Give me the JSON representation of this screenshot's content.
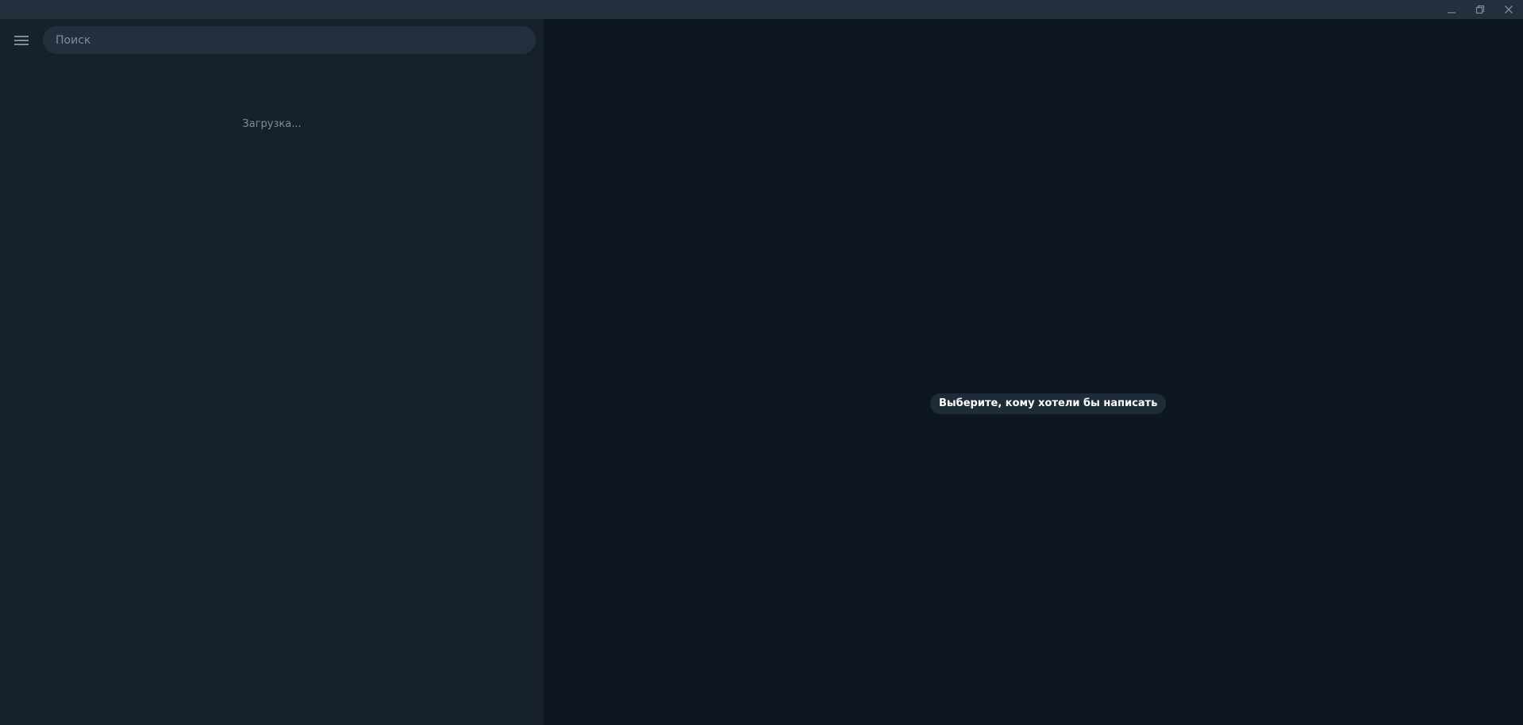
{
  "window": {
    "controls": [
      {
        "name": "minimize-icon"
      },
      {
        "name": "restore-icon"
      },
      {
        "name": "close-icon"
      }
    ]
  },
  "sidebar": {
    "menu_icon": "hamburger-menu-icon",
    "search": {
      "placeholder": "Поиск",
      "value": ""
    },
    "status": "Загрузка..."
  },
  "main": {
    "empty_message": "Выберите, кому хотели бы написать"
  },
  "colors": {
    "titlebar": "#242f3d",
    "sidebar_bg": "#17212b",
    "main_bg": "#0e1621",
    "search_bg": "#242f3d",
    "pill_bg": "#1e2c3a",
    "muted_text": "#7f8b97"
  }
}
